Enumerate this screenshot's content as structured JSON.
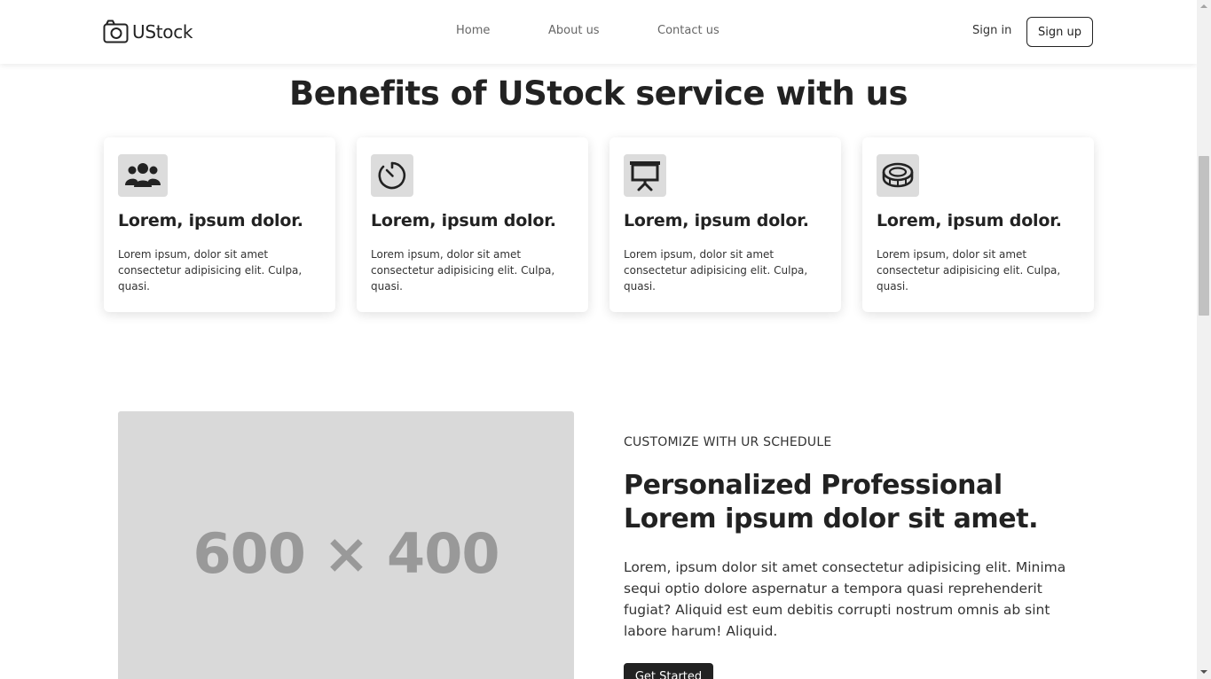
{
  "nav": {
    "brand": "UStock",
    "links": [
      "Home",
      "About us",
      "Contact us"
    ],
    "signin": "Sign in",
    "signup": "Sign up"
  },
  "benefits": {
    "title": "Benefits of UStock service with us",
    "cards": [
      {
        "icon": "users-icon",
        "title": "Lorem, ipsum dolor.",
        "text": "Lorem ipsum, dolor sit amet consectetur adipisicing elit. Culpa, quasi."
      },
      {
        "icon": "timer-icon",
        "title": "Lorem, ipsum dolor.",
        "text": "Lorem ipsum, dolor sit amet consectetur adipisicing elit. Culpa, quasi."
      },
      {
        "icon": "presentation-icon",
        "title": "Lorem, ipsum dolor.",
        "text": "Lorem ipsum, dolor sit amet consectetur adipisicing elit. Culpa, quasi."
      },
      {
        "icon": "coin-icon",
        "title": "Lorem, ipsum dolor.",
        "text": "Lorem ipsum, dolor sit amet consectetur adipisicing elit. Culpa, quasi."
      }
    ]
  },
  "feature": {
    "image_placeholder": "600 × 400",
    "eyebrow": "CUSTOMIZE WITH UR SCHEDULE",
    "title": "Personalized Professional Lorem ipsum dolor sit amet.",
    "text": "Lorem, ipsum dolor sit amet consectetur adipisicing elit. Minima sequi optio dolore aspernatur a tempora quasi reprehenderit fugiat? Aliquid est eum debitis corrupti nostrum omnis ab sint labore harum! Aliquid.",
    "cta": "Get Started"
  },
  "colors": {
    "text_dark": "#222222",
    "icon_bg": "#dcdcdc",
    "placeholder_bg": "#d9d9d9",
    "button_bg": "#222222"
  }
}
